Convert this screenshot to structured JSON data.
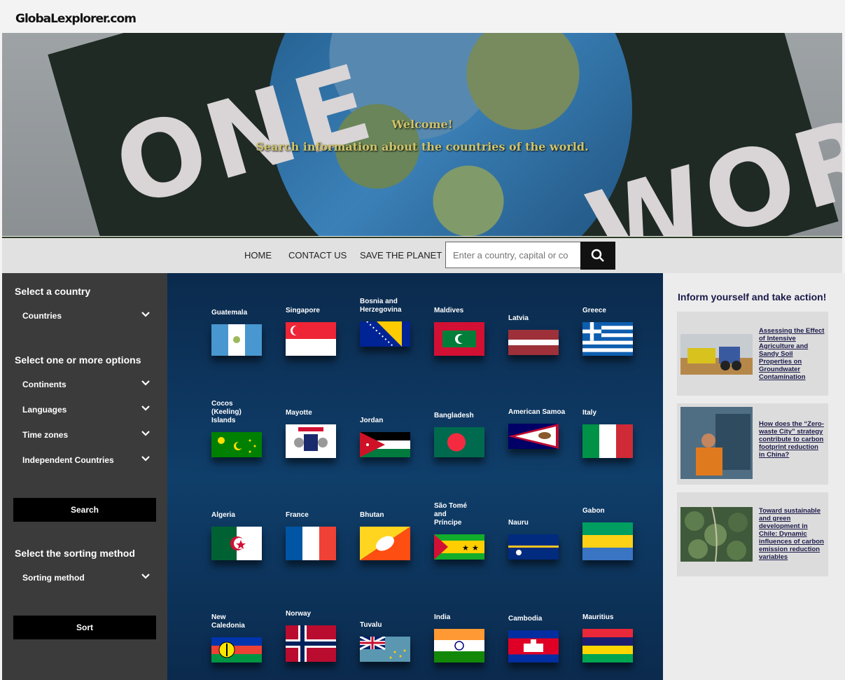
{
  "site": {
    "logo": "GlobaLexplorer.com"
  },
  "hero": {
    "welcome": "Welcome!",
    "subtitle": "Search information about the countries of the world.",
    "sign_word_left": "ONE",
    "sign_word_right": "WORLD"
  },
  "nav": {
    "links": [
      "HOME",
      "CONTACT US",
      "SAVE THE PLANET"
    ],
    "search_placeholder": "Enter a country, capital or co"
  },
  "sidebar": {
    "select_country_heading": "Select a country",
    "countries_select": "Countries",
    "options_heading": "Select one or more options",
    "filters": [
      "Continents",
      "Languages",
      "Time zones",
      "Independent Countries"
    ],
    "search_button": "Search",
    "sort_heading": "Select the sorting method",
    "sort_select": "Sorting method",
    "sort_button": "Sort"
  },
  "countries": [
    "Guatemala",
    "Singapore",
    "Bosnia and Herzegovina",
    "Maldives",
    "Latvia",
    "Greece",
    "Cocos (Keeling) Islands",
    "Mayotte",
    "Jordan",
    "Bangladesh",
    "American Samoa",
    "Italy",
    "Algeria",
    "France",
    "Bhutan",
    "São Tomé and Príncipe",
    "Nauru",
    "Gabon",
    "New Caledonia",
    "Norway",
    "Tuvalu",
    "India",
    "Cambodia",
    "Mauritius"
  ],
  "aside": {
    "title": "Inform yourself and take action!",
    "articles": [
      {
        "title": "Assessing the Effect of Intensive Agriculture and Sandy Soil Properties on Groundwater Contamination"
      },
      {
        "title": "How does the “Zero-waste City” strategy contribute to carbon footprint reduction in China?"
      },
      {
        "title": "Toward sustainable and green development in Chile: Dynamic influences of carbon emission reduction variables"
      }
    ]
  },
  "colors": {
    "sidebar_bg": "#3b3b3b",
    "main_bg": "#0f3e6a",
    "accent_text": "#cfc46a",
    "button_bg": "#000000"
  }
}
